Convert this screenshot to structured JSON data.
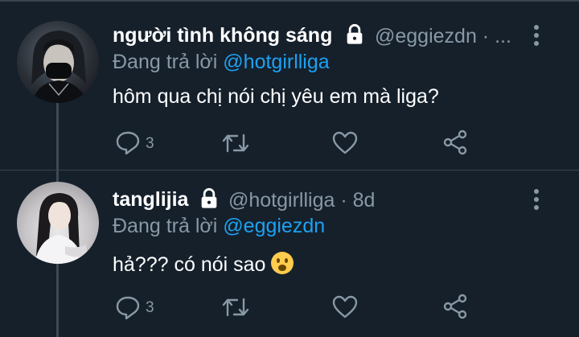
{
  "tweets": [
    {
      "author": "người tình không sáng",
      "handle": "@eggiezdn · ...",
      "reply_prefix": "Đang trả lời ",
      "reply_to": "@hotgirlliga",
      "text": "hôm qua chị nói chị yêu em mà liga?",
      "reply_count": "3",
      "icons": [
        "reply-icon",
        "retweet-icon",
        "like-icon",
        "share-icon"
      ]
    },
    {
      "author": "tanglijia",
      "handle": "@hotgirlliga · 8d",
      "reply_prefix": "Đang trả lời ",
      "reply_to": "@eggiezdn",
      "text": "hả??? có nói sao",
      "emoji": "frowning-face-emoji",
      "reply_count": "3",
      "icons": [
        "reply-icon",
        "retweet-icon",
        "like-icon",
        "share-icon"
      ]
    }
  ],
  "colors": {
    "background": "#15202b",
    "secondary_text": "#8899a6",
    "mention": "#1da1f2",
    "primary_text": "#ffffff"
  }
}
